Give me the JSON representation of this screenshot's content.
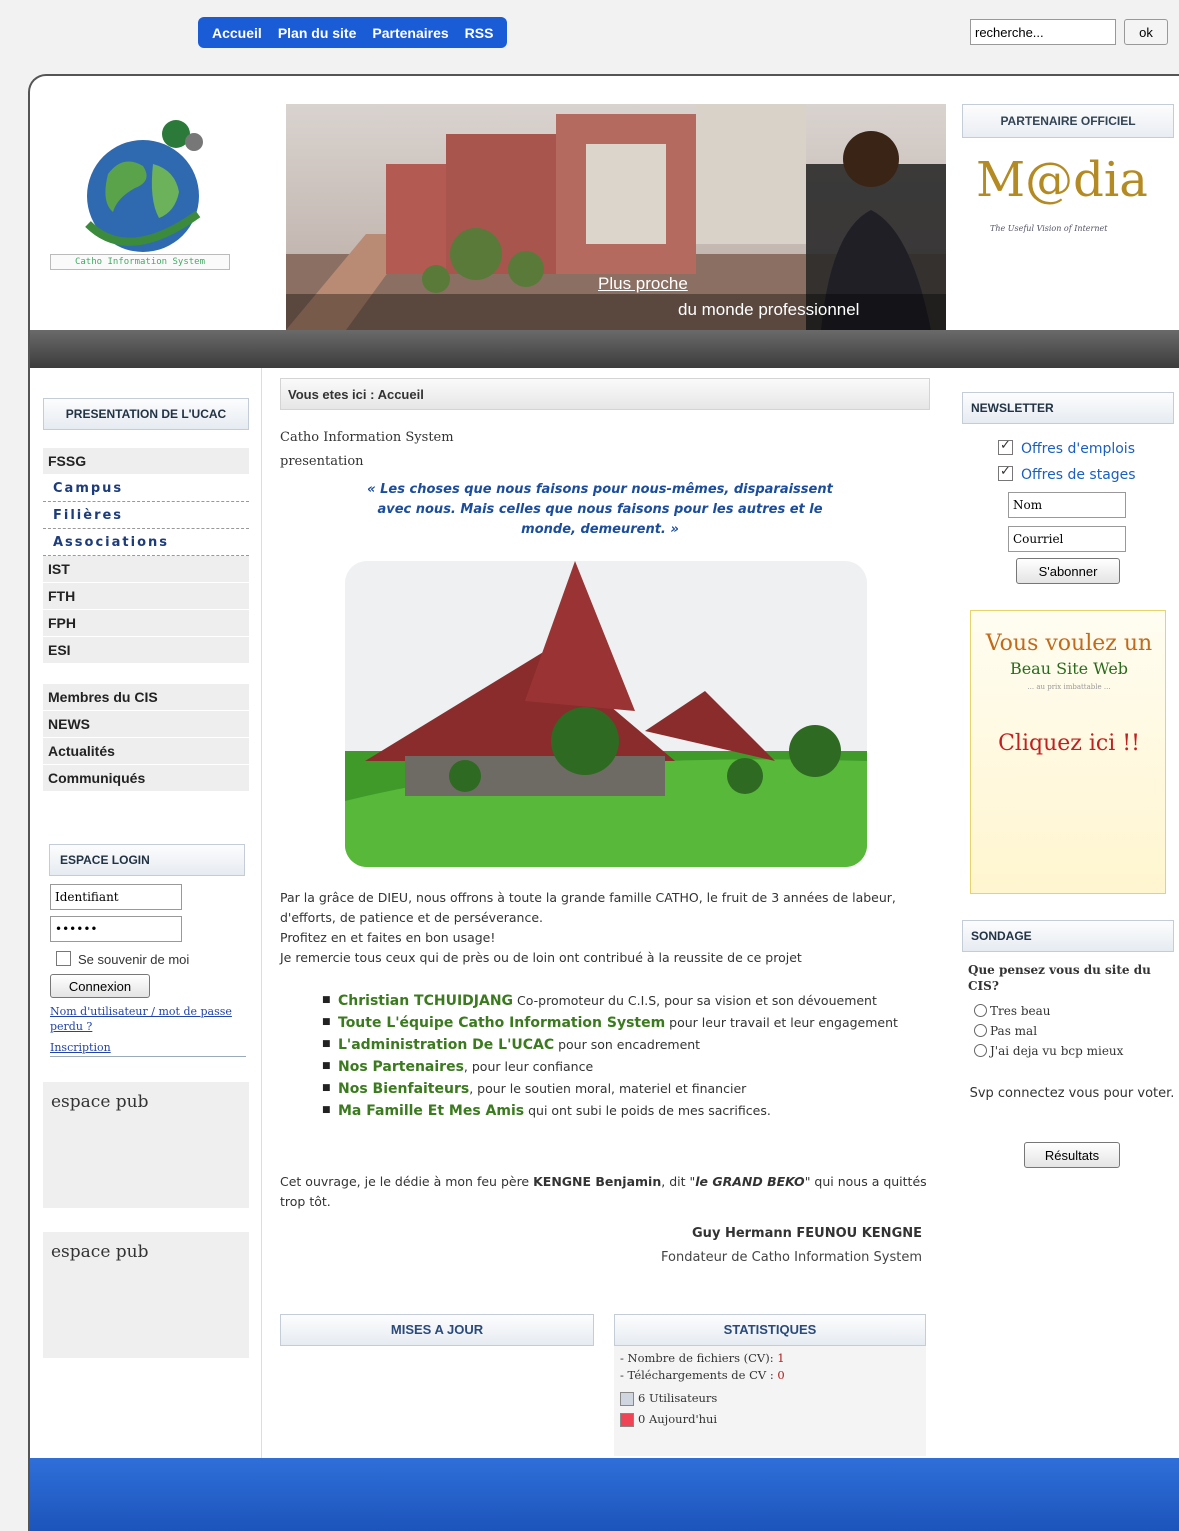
{
  "topnav": {
    "items": [
      "Accueil",
      "Plan du site",
      "Partenaires",
      "RSS"
    ]
  },
  "search": {
    "value": "recherche...",
    "button": "ok"
  },
  "header": {
    "logo_caption": "Catho Information System",
    "banner_line1": "Plus proche",
    "banner_line2": "du monde professionnel",
    "partner_title": "PARTENAIRE OFFICIEL",
    "partner_logo": "M@dia",
    "partner_tagline": "The Useful Vision of Internet"
  },
  "left": {
    "presentation_title": "PRESENTATION DE L'UCAC",
    "nav1": [
      "FSSG"
    ],
    "subs": [
      "Campus",
      "Filières",
      "Associations"
    ],
    "nav2": [
      "IST",
      "FTH",
      "FPH",
      "ESI"
    ],
    "nav3": [
      "Membres du CIS",
      "NEWS",
      "Actualités",
      "Communiqués"
    ],
    "login_title": "ESPACE LOGIN",
    "login_user": "Identifiant",
    "login_pass": "••••••",
    "remember": "Se souvenir de moi",
    "connect": "Connexion",
    "lost": "Nom d'utilisateur / mot de passe perdu ?",
    "register": "Inscription",
    "pub1": "espace pub",
    "pub2": "espace pub"
  },
  "main": {
    "breadcrumb": "Vous etes ici : Accueil",
    "line1": "Catho Information System",
    "line2": "presentation",
    "quote": "« Les choses que nous faisons pour nous-mêmes, disparaissent avec nous. Mais celles que nous faisons pour les autres et le monde, demeurent. »",
    "para1": "Par la grâce de DIEU, nous offrons à toute la grande famille CATHO, le fruit de 3 années de labeur, d'efforts, de patience et de  perséverance.",
    "para2": " Profitez en  et faites en bon usage!",
    "para3": "Je remercie tous ceux qui de près ou de loin ont contribué à la reussite de ce projet",
    "thanks": [
      {
        "name": "Christian TCHUIDJANG",
        "rest": " Co-promoteur du C.I.S,  pour sa vision et son dévouement"
      },
      {
        "name": "Toute L'équipe Catho Information System",
        "rest": "  pour leur travail et leur engagement"
      },
      {
        "name": "L'administration De L'UCAC",
        "rest": " pour son encadrement"
      },
      {
        "name": " Nos Partenaires",
        "rest": ", pour leur confiance"
      },
      {
        "name": "Nos Bienfaiteurs",
        "rest": ", pour le soutien moral, materiel et financier"
      },
      {
        "name": "Ma Famille Et Mes Amis",
        "rest": " qui ont subi le poids de mes sacrifices."
      }
    ],
    "dedic_a": "Cet ouvrage, je le dédie à mon feu père ",
    "dedic_b": "KENGNE Benjamin",
    "dedic_c": ", dit \"",
    "dedic_d": "le GRAND BEKO",
    "dedic_e": "\" qui nous a quittés trop tôt.",
    "sign_name": "Guy Hermann FEUNOU KENGNE",
    "sign_role": "Fondateur de Catho Information System",
    "updates_title": "MISES A JOUR",
    "stats_title": "STATISTIQUES",
    "stat_files_label": "- Nombre de fichiers (CV): ",
    "stat_files": "1",
    "stat_dl_label": "- Téléchargements de CV : ",
    "stat_dl": "0",
    "stat_users": "6 Utilisateurs",
    "stat_today": "0 Aujourd'hui"
  },
  "right": {
    "newsletter_title": "NEWSLETTER",
    "opt1": "Offres d'emplois",
    "opt2": "Offres de stages",
    "name_ph": "Nom",
    "mail_ph": "Courriel",
    "subscribe": "S'abonner",
    "ad_line1": "Vous voulez un",
    "ad_line2": "Beau Site Web",
    "ad_line3": "... au prix imbattable ...",
    "ad_cta": "Cliquez ici !!",
    "poll_title": "SONDAGE",
    "question": "Que pensez vous du site du CIS?",
    "options": [
      "Tres beau",
      "Pas mal",
      "J'ai deja vu bcp mieux"
    ],
    "please": "Svp connectez vous pour voter.",
    "results": "Résultats"
  }
}
